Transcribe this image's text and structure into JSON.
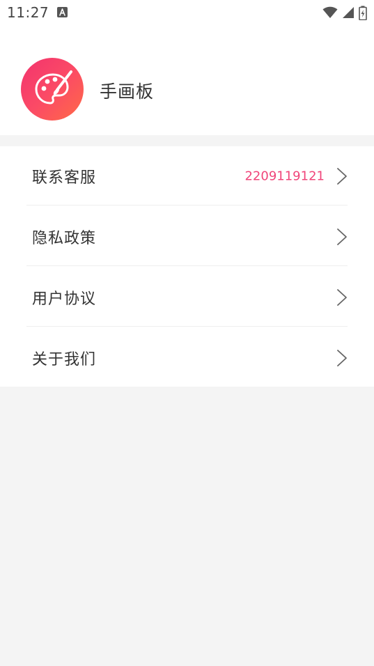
{
  "status_bar": {
    "time": "11:27",
    "notification_icon": "text-a-icon",
    "icons": [
      "wifi-icon",
      "signal-icon",
      "battery-charging-icon"
    ]
  },
  "header": {
    "app_name": "手画板",
    "logo_icon": "palette-icon",
    "logo_gradient": [
      "#f2336e",
      "#ff6a46"
    ]
  },
  "menu": {
    "items": [
      {
        "label": "联系客服",
        "value": "2209119121",
        "icon": "chevron-right-icon"
      },
      {
        "label": "隐私政策",
        "icon": "chevron-right-icon"
      },
      {
        "label": "用户协议",
        "icon": "chevron-right-icon"
      },
      {
        "label": "关于我们",
        "icon": "chevron-right-icon"
      }
    ]
  },
  "colors": {
    "accent": "#f0457a",
    "text": "#333333",
    "background": "#f4f4f4",
    "card": "#ffffff"
  }
}
